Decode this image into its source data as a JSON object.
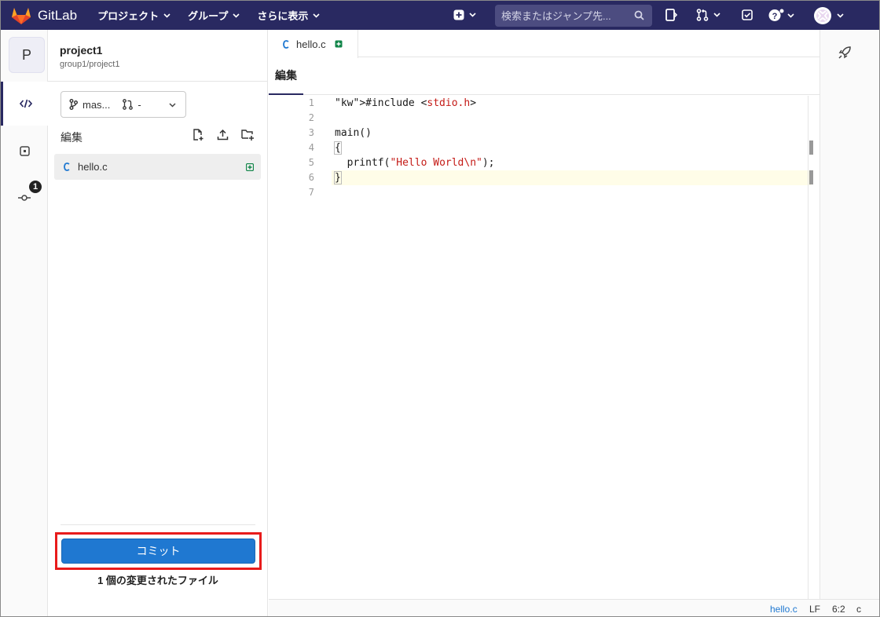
{
  "topbar": {
    "logo_text": "GitLab",
    "menus": [
      "プロジェクト",
      "グループ",
      "さらに表示"
    ],
    "search_placeholder": "検索またはジャンプ先..."
  },
  "project": {
    "avatar_letter": "P",
    "name": "project1",
    "path": "group1/project1"
  },
  "branch": {
    "branch_label": "mas...",
    "mr_label": "-"
  },
  "tree": {
    "title": "編集",
    "files": [
      {
        "name": "hello.c",
        "icon": "c-file-icon",
        "status": "added"
      }
    ]
  },
  "commit": {
    "button_label": "コミット",
    "changes_text": "1 個の変更されたファイル"
  },
  "rail": {
    "commit_badge": "1"
  },
  "editor": {
    "tab_name": "hello.c",
    "mode_label": "編集",
    "line_numbers": [
      "1",
      "2",
      "3",
      "4",
      "5",
      "6",
      "7"
    ],
    "lines": [
      "#include <stdio.h>",
      "",
      "main()",
      "{",
      "  printf(\"Hello World\\n\");",
      "}",
      ""
    ]
  },
  "status": {
    "file": "hello.c",
    "eol": "LF",
    "position": "6:2",
    "language": "c"
  },
  "colors": {
    "navbar": "#292961",
    "primary": "#1f78d1",
    "highlight_border": "#e81b1b",
    "added": "#108548"
  }
}
